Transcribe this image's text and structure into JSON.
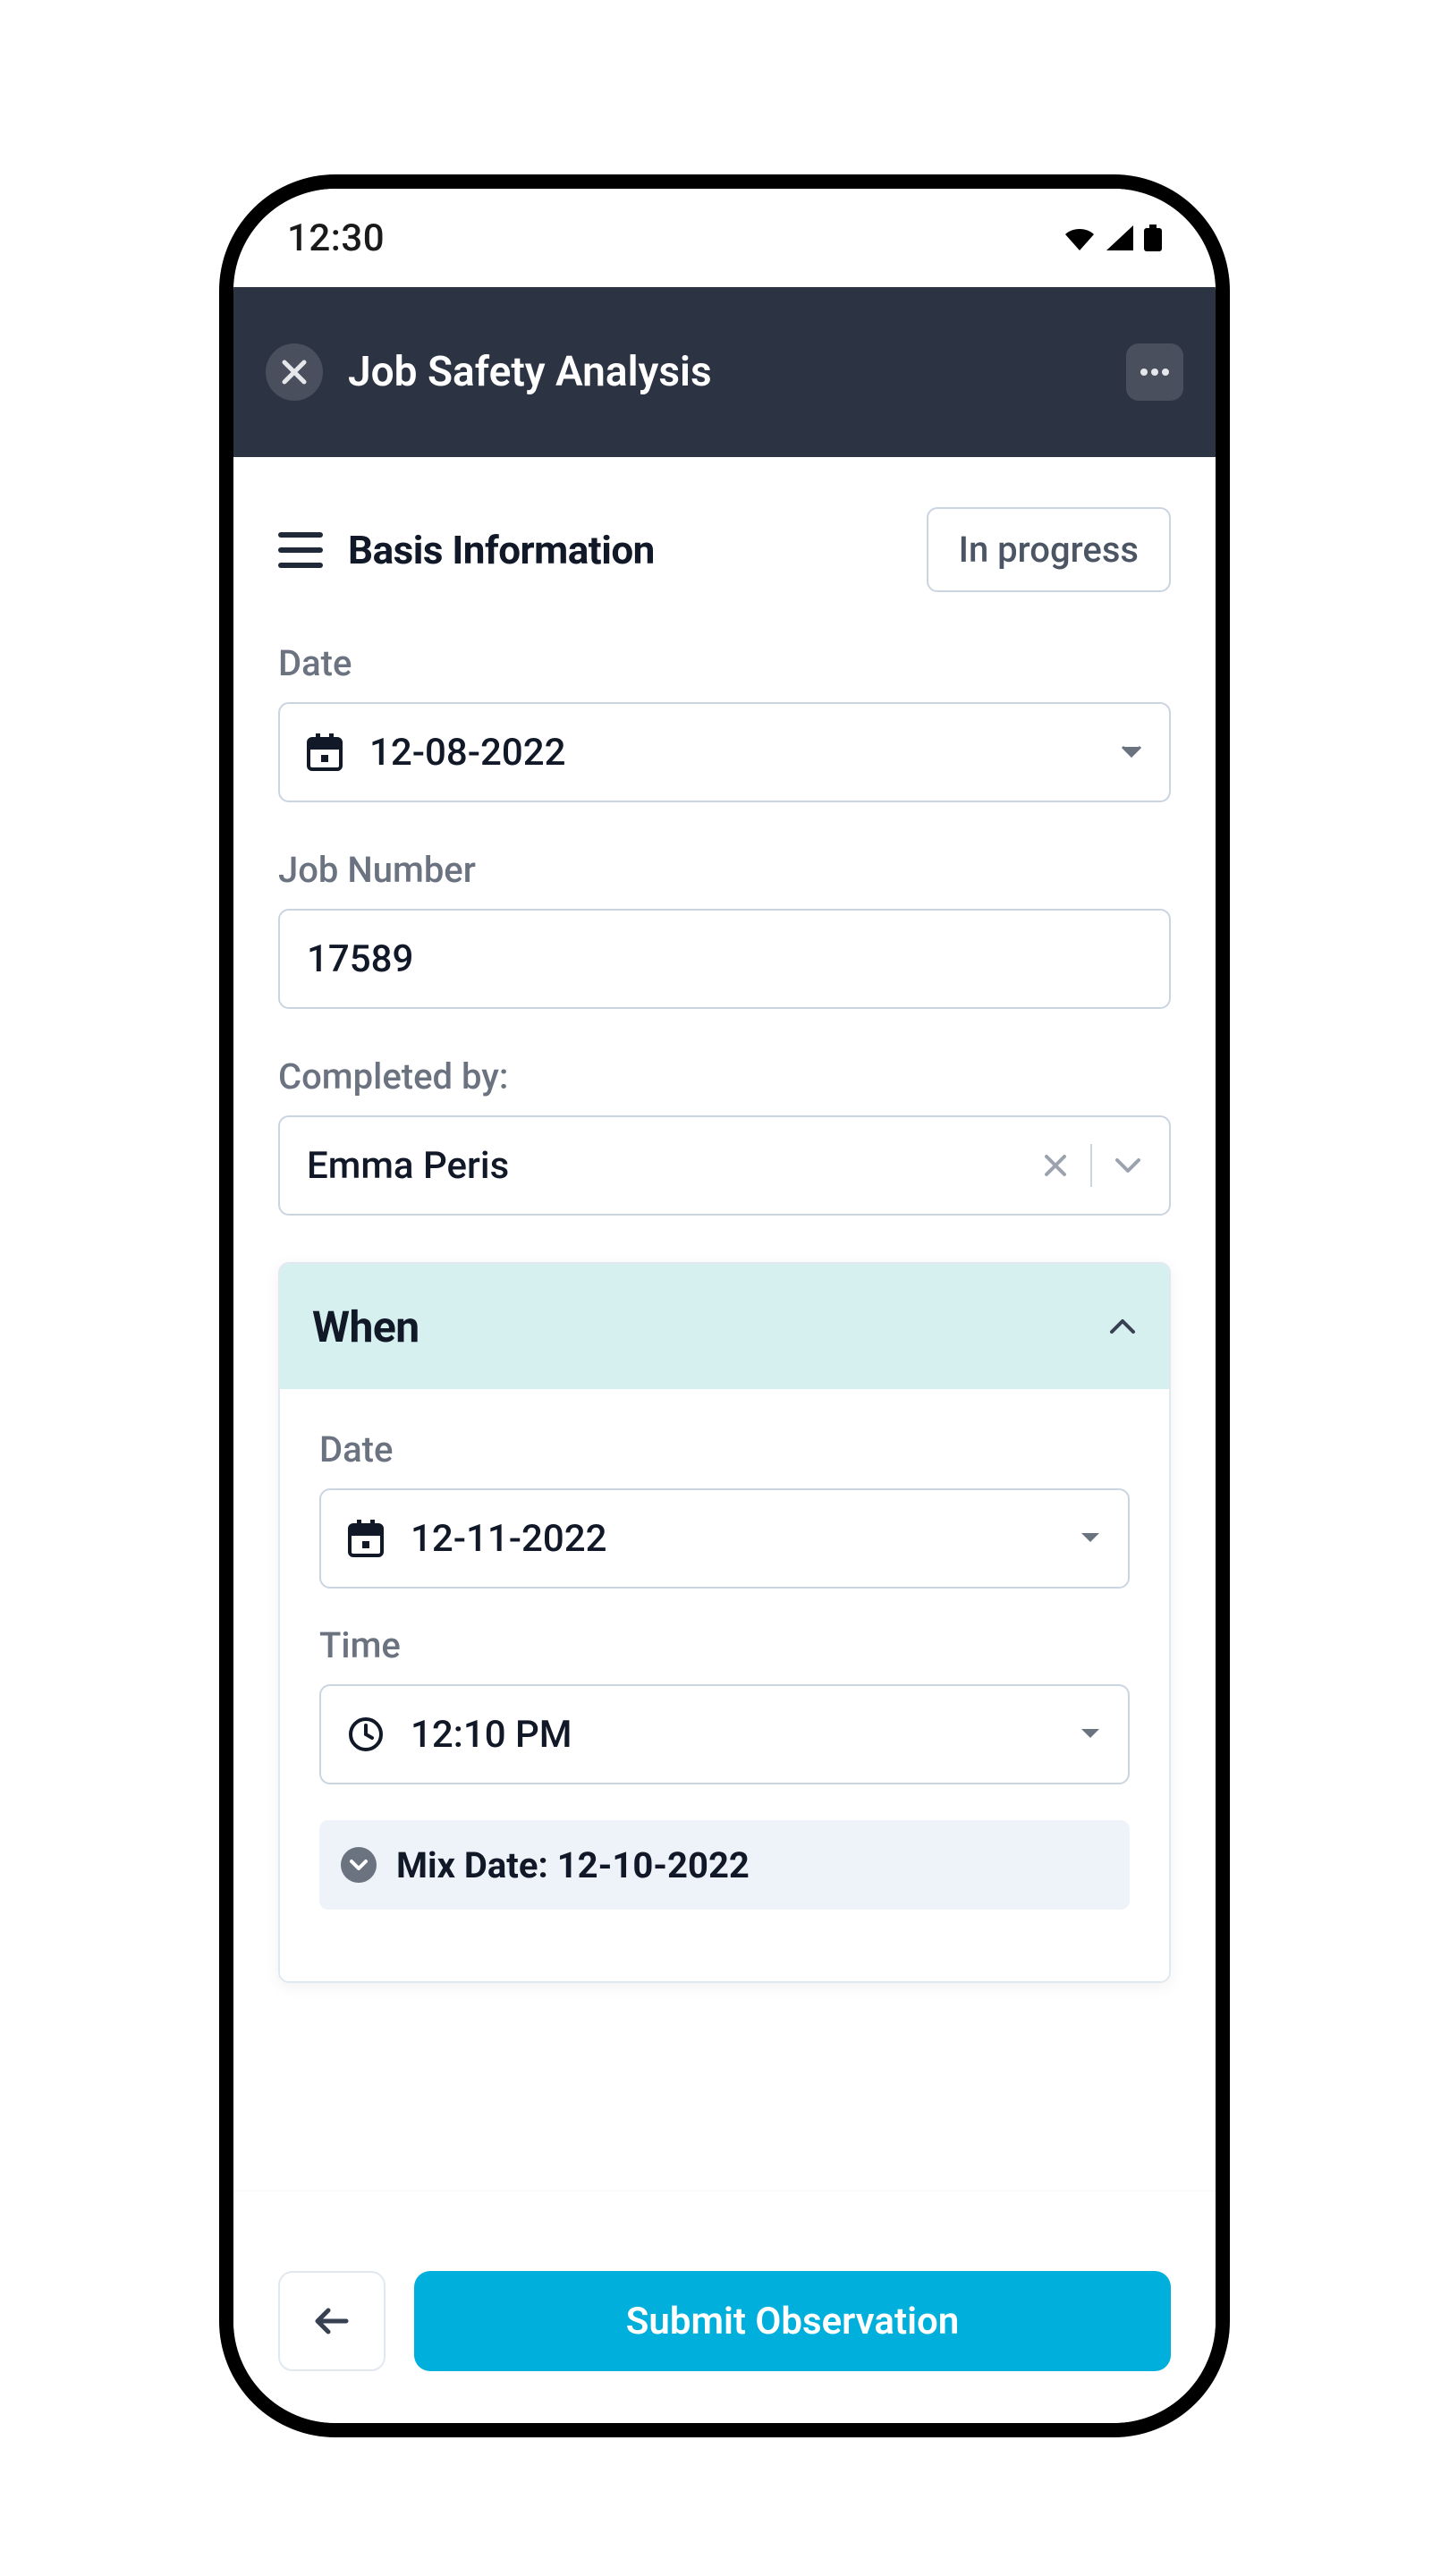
{
  "status_bar": {
    "time": "12:30"
  },
  "header": {
    "title": "Job Safety Analysis"
  },
  "section": {
    "title": "Basis Information",
    "status": "In progress"
  },
  "form": {
    "date": {
      "label": "Date",
      "value": "12-08-2022"
    },
    "job_number": {
      "label": "Job Number",
      "value": "17589"
    },
    "completed_by": {
      "label": "Completed by:",
      "value": "Emma Peris"
    }
  },
  "when": {
    "title": "When",
    "date": {
      "label": "Date",
      "value": "12-11-2022"
    },
    "time": {
      "label": "Time",
      "value": "12:10 PM"
    },
    "mix_date": {
      "label": "Mix Date:",
      "value": "12-10-2022"
    }
  },
  "footer": {
    "submit": "Submit Observation"
  },
  "colors": {
    "accent": "#00afdb",
    "header_bg": "#2c3342",
    "when_header_bg": "#d6f0ef"
  }
}
